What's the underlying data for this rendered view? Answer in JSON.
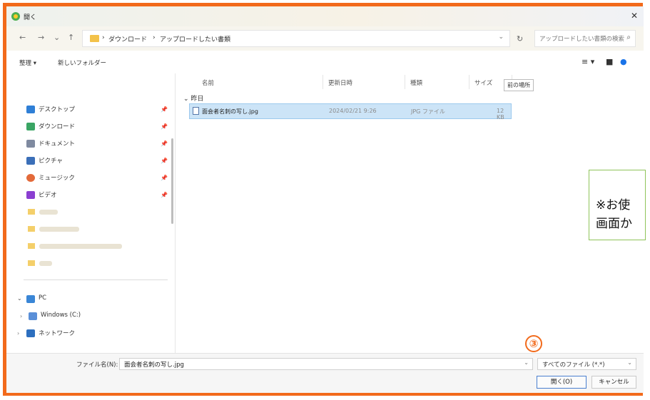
{
  "window": {
    "title": "開く"
  },
  "nav": {
    "back": "←",
    "forward": "→",
    "down": "⌄",
    "up": "↑",
    "refresh": "↻"
  },
  "address": {
    "crumbs": [
      "›",
      "ダウンロード",
      "›",
      "アップロードしたい書類"
    ]
  },
  "search": {
    "placeholder": "アップロードしたい書類の検索"
  },
  "commands": {
    "organize": "整理 ▾",
    "new_folder": "新しいフォルダー"
  },
  "sidebar": {
    "items": [
      {
        "label": "デスクトップ",
        "color": "#2f7fd6"
      },
      {
        "label": "ダウンロード",
        "color": "#3aa564"
      },
      {
        "label": "ドキュメント",
        "color": "#7f8aa0"
      },
      {
        "label": "ピクチャ",
        "color": "#3b6fb8"
      },
      {
        "label": "ミュージック",
        "color": "#e36a3a"
      },
      {
        "label": "ビデオ",
        "color": "#8b3fd1"
      }
    ],
    "pc": "PC",
    "windows": "Windows (C:)",
    "network": "ネットワーク"
  },
  "content": {
    "columns": [
      "名前",
      "更新日時",
      "種類",
      "サイズ"
    ],
    "tooltip": "前の場所",
    "group": "昨日",
    "file": {
      "name": "面会者名刺の写し.jpg",
      "date": "2024/02/21 9:26",
      "type": "JPG ファイル",
      "size": "12 KB"
    }
  },
  "callout": {
    "line1": "※お使",
    "line2": "画面か"
  },
  "footer": {
    "filename_label": "ファイル名(N):",
    "filename_value": "面会者名刺の写し.jpg",
    "filter": "すべてのファイル (*.*)",
    "open": "開く(O)",
    "cancel": "キャンセル"
  },
  "step": "③",
  "colors": {
    "accent_frame": "#f26a1b",
    "selection": "#cce4f7",
    "callout_border": "#8fc45a"
  }
}
